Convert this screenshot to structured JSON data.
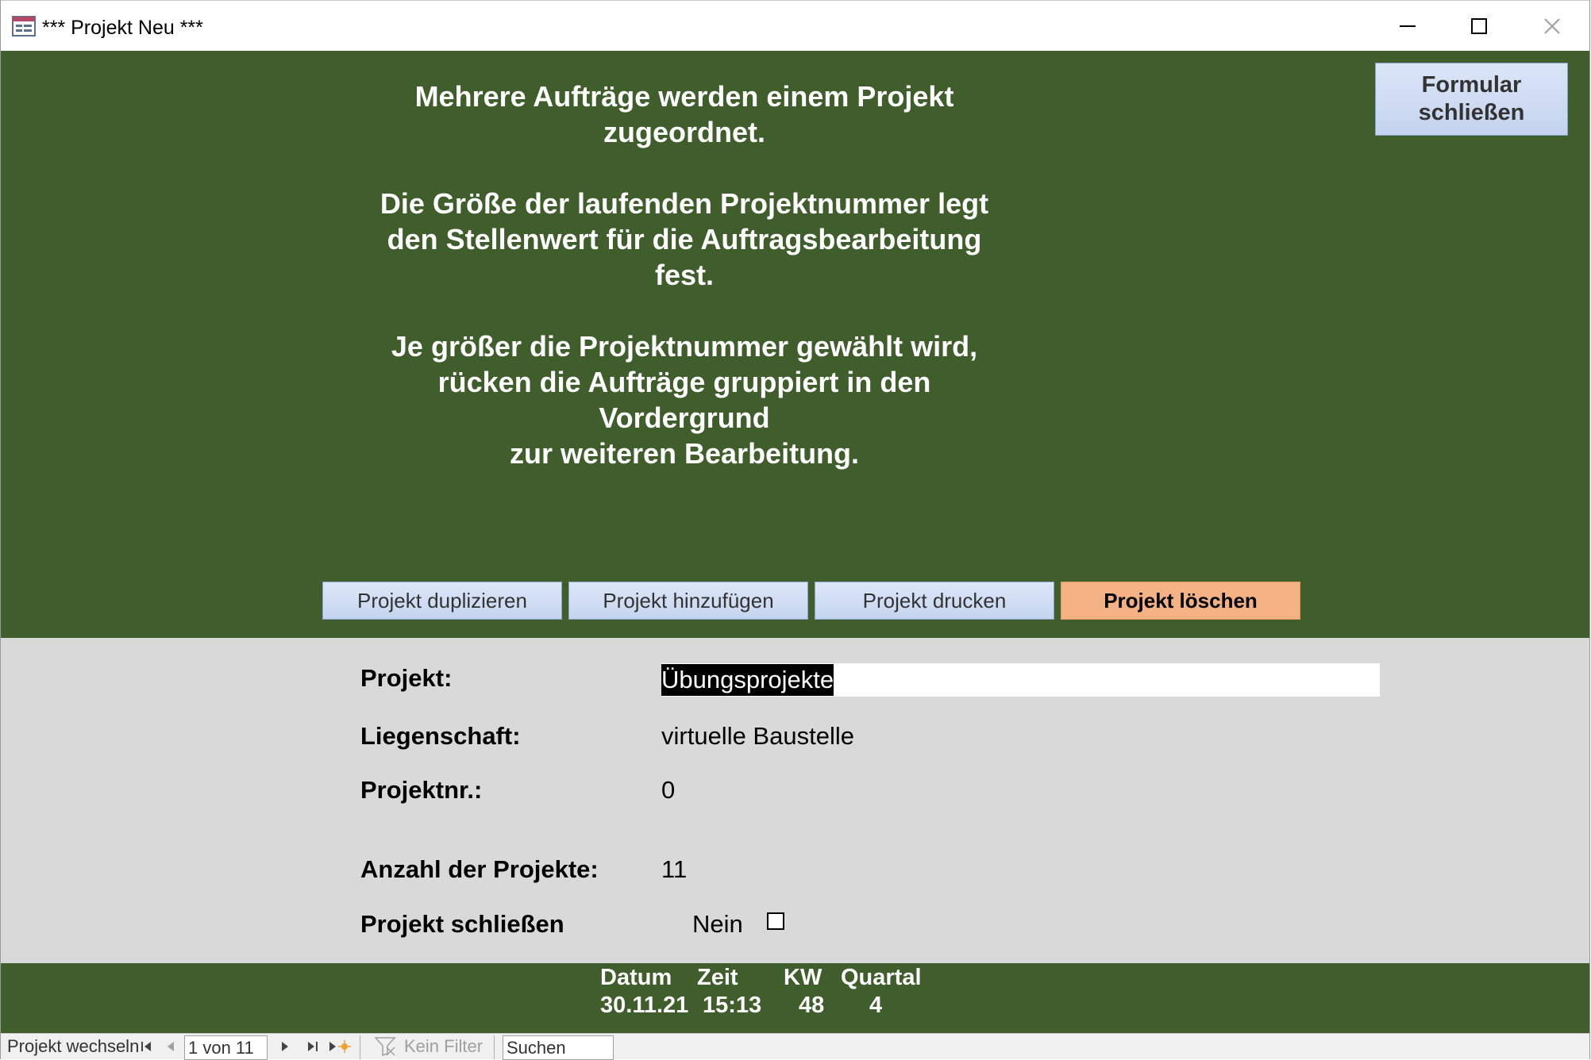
{
  "window": {
    "title": "*** Projekt Neu ***"
  },
  "header": {
    "intro_text": "Mehrere Aufträge werden einem Projekt\nzugeordnet.\n\nDie Größe der laufenden Projektnummer legt\nden Stellenwert für die Auftragsbearbeitung\nfest.\n\nJe größer die Projektnummer gewählt wird,\nrücken die Aufträge gruppiert in den\nVordergrund\nzur weiteren Bearbeitung.",
    "close_form_label": "Formular\nschließen"
  },
  "actions": {
    "duplicate": "Projekt duplizieren",
    "add": "Projekt hinzufügen",
    "print": "Projekt drucken",
    "delete": "Projekt löschen"
  },
  "detail": {
    "projekt_label": "Projekt:",
    "projekt_value": "Übungsprojekte",
    "liegenschaft_label": "Liegenschaft:",
    "liegenschaft_value": "virtuelle Baustelle",
    "projektnr_label": "Projektnr.:",
    "projektnr_value": "0",
    "anzahl_label": "Anzahl der Projekte:",
    "anzahl_value": "11",
    "schliessen_label": "Projekt schließen",
    "schliessen_value": "Nein",
    "schliessen_checked": false
  },
  "footer": {
    "datum_label": "Datum",
    "datum_value": "30.11.21",
    "zeit_label": "Zeit",
    "zeit_value": "15:13",
    "kw_label": "KW",
    "kw_value": "48",
    "quartal_label": "Quartal",
    "quartal_value": "4"
  },
  "navbar": {
    "record_label": "Projekt wechseln",
    "record_position": "1 von 11",
    "filter_label": "Kein Filter",
    "search_placeholder": "Suchen"
  },
  "colors": {
    "header_green": "#3f5e2b",
    "detail_gray": "#d9d9d9",
    "delete_orange": "#f4b183",
    "button_blue": "#c5d4ef"
  }
}
